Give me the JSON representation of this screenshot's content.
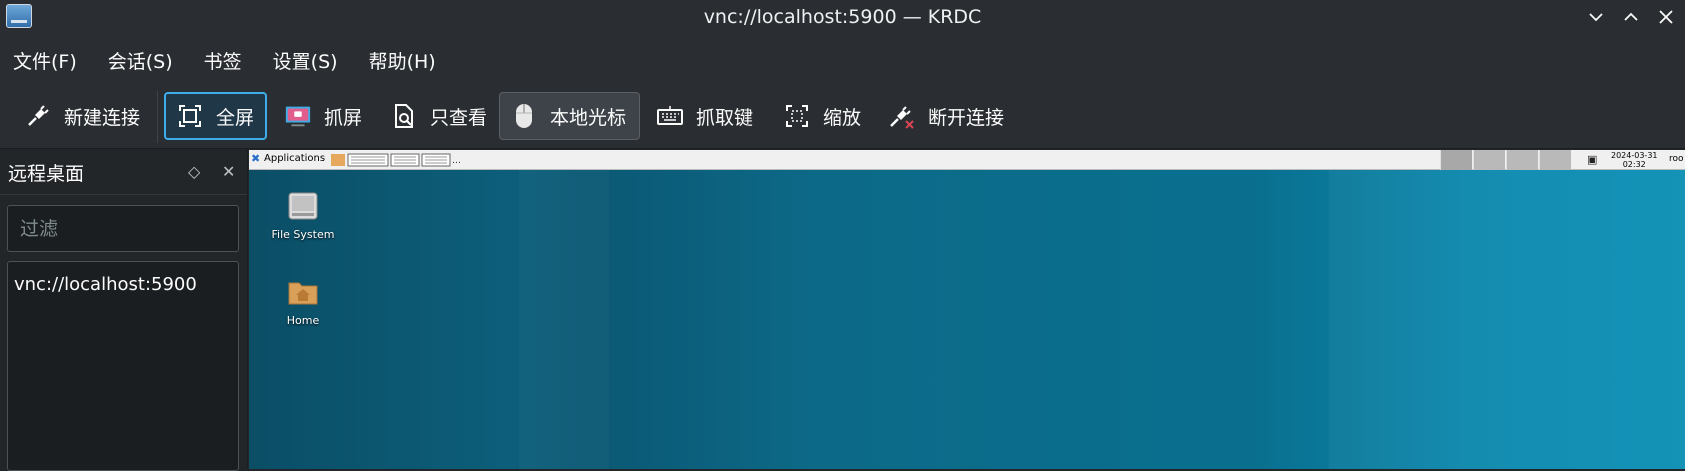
{
  "window": {
    "title": "vnc://localhost:5900 — KRDC",
    "icons": [
      "app-icon",
      "minimize-icon",
      "maximize-icon",
      "close-icon"
    ]
  },
  "menubar": {
    "items": [
      "文件(F)",
      "会话(S)",
      "书签",
      "设置(S)",
      "帮助(H)"
    ]
  },
  "toolbar": {
    "buttons": [
      {
        "label": "新建连接",
        "icon": "plug-icon"
      },
      {
        "label": "全屏",
        "icon": "fullscreen-icon",
        "state": "focused"
      },
      {
        "label": "抓屏",
        "icon": "screenshot-icon"
      },
      {
        "label": "只查看",
        "icon": "view-only-icon"
      },
      {
        "label": "本地光标",
        "icon": "mouse-icon",
        "state": "checked"
      },
      {
        "label": "抓取键",
        "icon": "keyboard-icon"
      },
      {
        "label": "缩放",
        "icon": "scale-icon"
      },
      {
        "label": "断开连接",
        "icon": "disconnect-icon"
      }
    ]
  },
  "sidepanel": {
    "title": "远程桌面",
    "filter_placeholder": "过滤",
    "items": [
      "vnc://localhost:5900"
    ]
  },
  "remote": {
    "panel": {
      "applications_label": "Applications",
      "clock_date": "2024-03-31",
      "clock_time": "02:32",
      "user": "roo"
    },
    "desktop_icons": [
      {
        "label": "File System",
        "icon": "drive-icon"
      },
      {
        "label": "Home",
        "icon": "home-folder-icon"
      }
    ]
  },
  "colors": {
    "accent": "#3daee9",
    "window_bg": "#2a2e32",
    "view_bg": "#1b1e20",
    "desktop": "#0b6f8f"
  }
}
